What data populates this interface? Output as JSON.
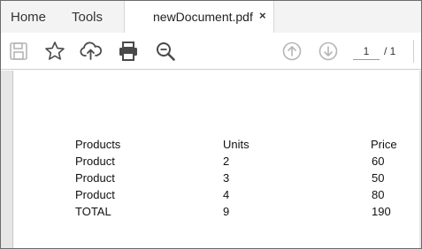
{
  "tabs": {
    "home": "Home",
    "tools": "Tools",
    "document": "newDocument.pdf",
    "close": "×"
  },
  "toolbar": {
    "icons": [
      "save-icon",
      "star-icon",
      "upload-cloud-icon",
      "print-icon",
      "zoom-icon",
      "page-up-icon",
      "page-down-icon"
    ],
    "current_page": "1",
    "page_total": "/ 1"
  },
  "table": {
    "headers": [
      "Products",
      "Units",
      "Price"
    ],
    "rows": [
      [
        "Product",
        "2",
        "60"
      ],
      [
        "Product",
        "3",
        "50"
      ],
      [
        "Product",
        "4",
        "80"
      ],
      [
        "TOTAL",
        "9",
        "190"
      ]
    ]
  }
}
